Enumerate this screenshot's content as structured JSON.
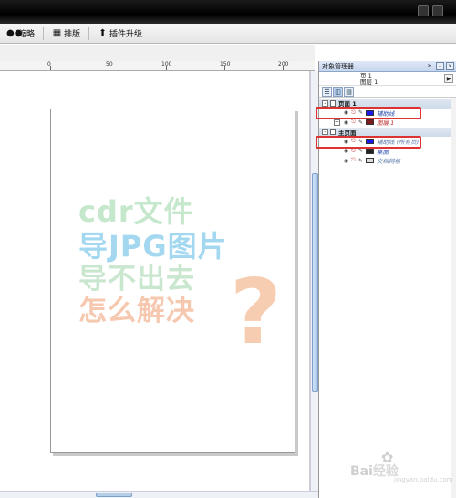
{
  "toolbar": {
    "items": [
      {
        "label": "缩略",
        "icon": "users-icon"
      },
      {
        "label": "排版",
        "icon": "layout-grid-icon"
      },
      {
        "label": "插件升级",
        "icon": "upload-arrow-icon"
      }
    ]
  },
  "ruler": {
    "labels": [
      "0",
      "50",
      "100",
      "150",
      "200"
    ]
  },
  "canvas": {
    "overlay_lines": [
      "cdr文件",
      "导JPG图片",
      "导不出去",
      "怎么解决"
    ],
    "question_mark": "?"
  },
  "watermark": {
    "brand_prefix": "Bai",
    "brand_suffix": "经验",
    "site": "jingyan.baidu.com"
  },
  "panel": {
    "title": "对象管理器",
    "page_line": "页 1",
    "layer_line": "图层 1",
    "groups": [
      {
        "label": "页面 1",
        "layers": [
          {
            "label": "辅助线",
            "color": "#1a1aee",
            "name_style": "blue"
          },
          {
            "label": "图层 1",
            "color": "#7a1a1a",
            "name_style": "red"
          }
        ]
      },
      {
        "label": "主页面",
        "layers": [
          {
            "label": "辅助线 (所有页)",
            "color": "#1a1aee",
            "name_style": "gray"
          },
          {
            "label": "桌面",
            "color": "#222222",
            "name_style": "blue"
          },
          {
            "label": "文档网格",
            "color": "#dddddd",
            "name_style": "gray"
          }
        ]
      }
    ]
  },
  "colors": {
    "highlight": "#dd3333",
    "accent_panel": "#c6d6ee"
  }
}
